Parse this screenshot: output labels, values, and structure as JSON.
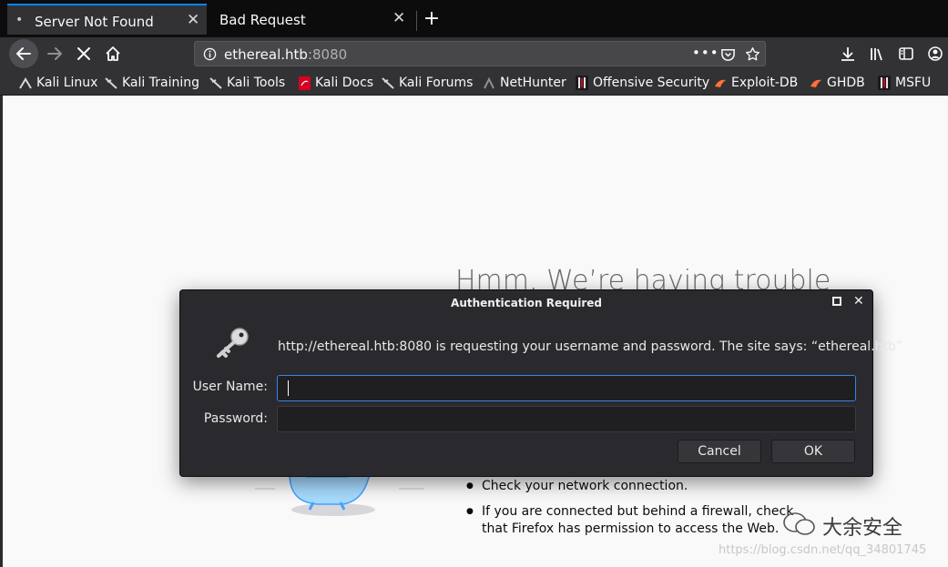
{
  "tabs": [
    {
      "label": "Server Not Found",
      "close": "✕"
    },
    {
      "label": "Bad Request",
      "close": "✕"
    }
  ],
  "toolbar": {
    "new_tab": "+",
    "page_actions": "•••"
  },
  "url": {
    "host": "ethereal.htb",
    "port": ":8080"
  },
  "bookmarks": [
    "Kali Linux",
    "Kali Training",
    "Kali Tools",
    "Kali Docs",
    "Kali Forums",
    "NetHunter",
    "Offensive Security",
    "Exploit-DB",
    "GHDB",
    "MSFU"
  ],
  "page": {
    "title": "Hmm. We’re having trouble",
    "bullets": [
      "Check your network connection.",
      "If you are connected but behind a firewall, check that Firefox has permission to access the Web."
    ]
  },
  "dialog": {
    "title": "Authentication Required",
    "message": "http://ethereal.htb:8080 is requesting your username and password. The site says: “ethereal.htb”",
    "username_label": "User Name:",
    "password_label": "Password:",
    "username_value": "",
    "password_value": "",
    "cancel": "Cancel",
    "ok": "OK",
    "close": "✕"
  },
  "watermark": {
    "name": "大余安全",
    "url": "https://blog.csdn.net/qq_34801745"
  },
  "colors": {
    "accent": "#0a84ff",
    "focus": "#3584e4",
    "chrome": "#323234",
    "tabstrip": "#0c0c0d"
  }
}
